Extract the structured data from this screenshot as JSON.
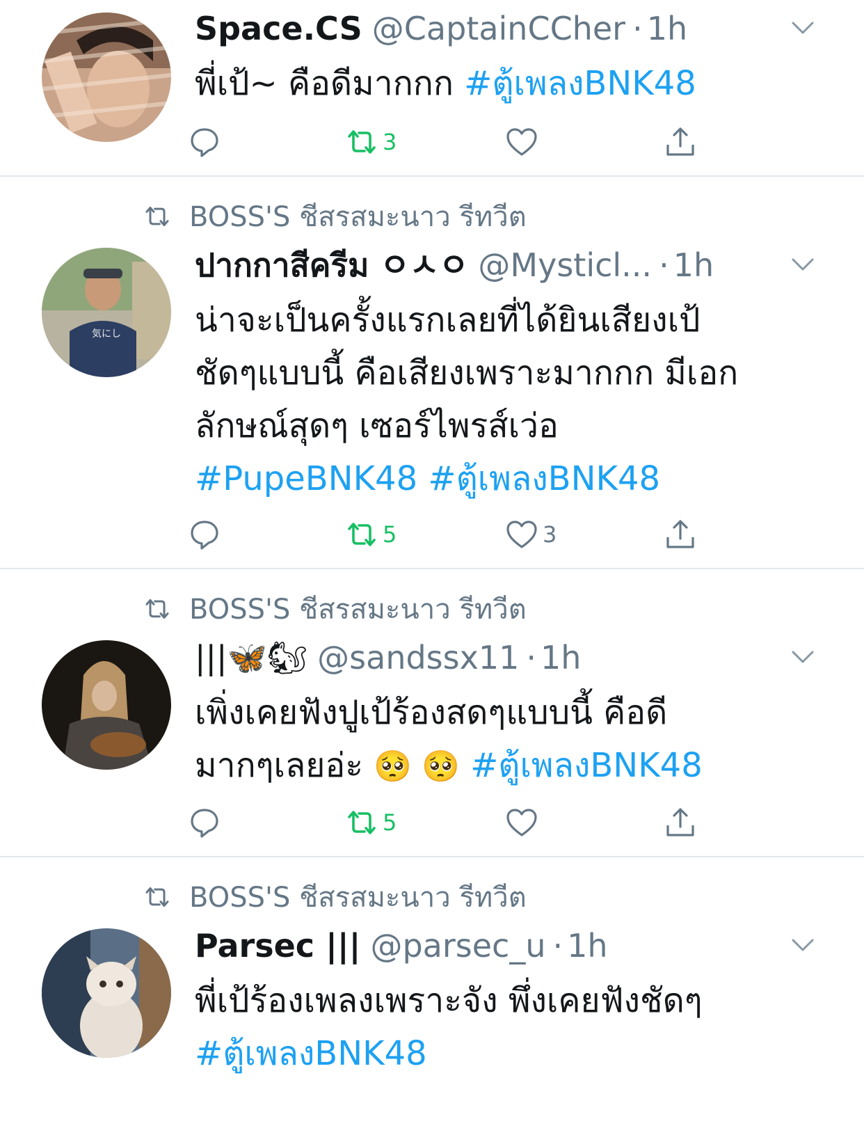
{
  "colors": {
    "link": "#1da1f2",
    "retweet_active": "#17bf63",
    "secondary_text": "#657786",
    "divider": "#e1e8ed"
  },
  "tweets": [
    {
      "retweeted_by": "",
      "name": "Space.CS",
      "handle": "@CaptainCCher",
      "time": "1h",
      "text": "พี่เป้~ คือดีมากกก ",
      "hashtags": "#ตู้เพลงBNK48",
      "replies": "",
      "retweets": "3",
      "likes": ""
    },
    {
      "retweeted_by": "BOSS'S ชีสรสมะนาว รีทวีต",
      "name": "ปากกาสีครีม ㅇㅅㅇ",
      "handle": "@Mysticl...",
      "time": "1h",
      "text_lines": [
        "น่าจะเป็นครั้งแรกเลยที่ได้ยินเสียงเป้",
        "ชัดๆแบบนี้ คือเสียงเพราะมากกก มีเอก",
        "ลักษณ์สุดๆ เซอร์ไพรส์เว่อ"
      ],
      "hashtags": "#PupeBNK48 #ตู้เพลงBNK48",
      "replies": "",
      "retweets": "5",
      "likes": "3"
    },
    {
      "retweeted_by": "BOSS'S ชีสรสมะนาว รีทวีต",
      "name": "|||🦋🐿",
      "handle": "@sandssx11",
      "time": "1h",
      "text_line1": "เพิ่งเคยฟังปูเป้ร้องสดๆแบบนี้ คือดี",
      "text_line2": "มากๆเลยอ่ะ ",
      "emojis": "🥺 🥺",
      "hashtags": "#ตู้เพลงBNK48",
      "replies": "",
      "retweets": "5",
      "likes": ""
    },
    {
      "retweeted_by": "BOSS'S ชีสรสมะนาว รีทวีต",
      "name": "Parsec |||",
      "handle": "@parsec_u",
      "time": "1h",
      "text": "พี่เป้ร้องเพลงเพราะจัง พึ่งเคยฟังชัดๆ",
      "hashtags": "#ตู้เพลงBNK48"
    }
  ]
}
